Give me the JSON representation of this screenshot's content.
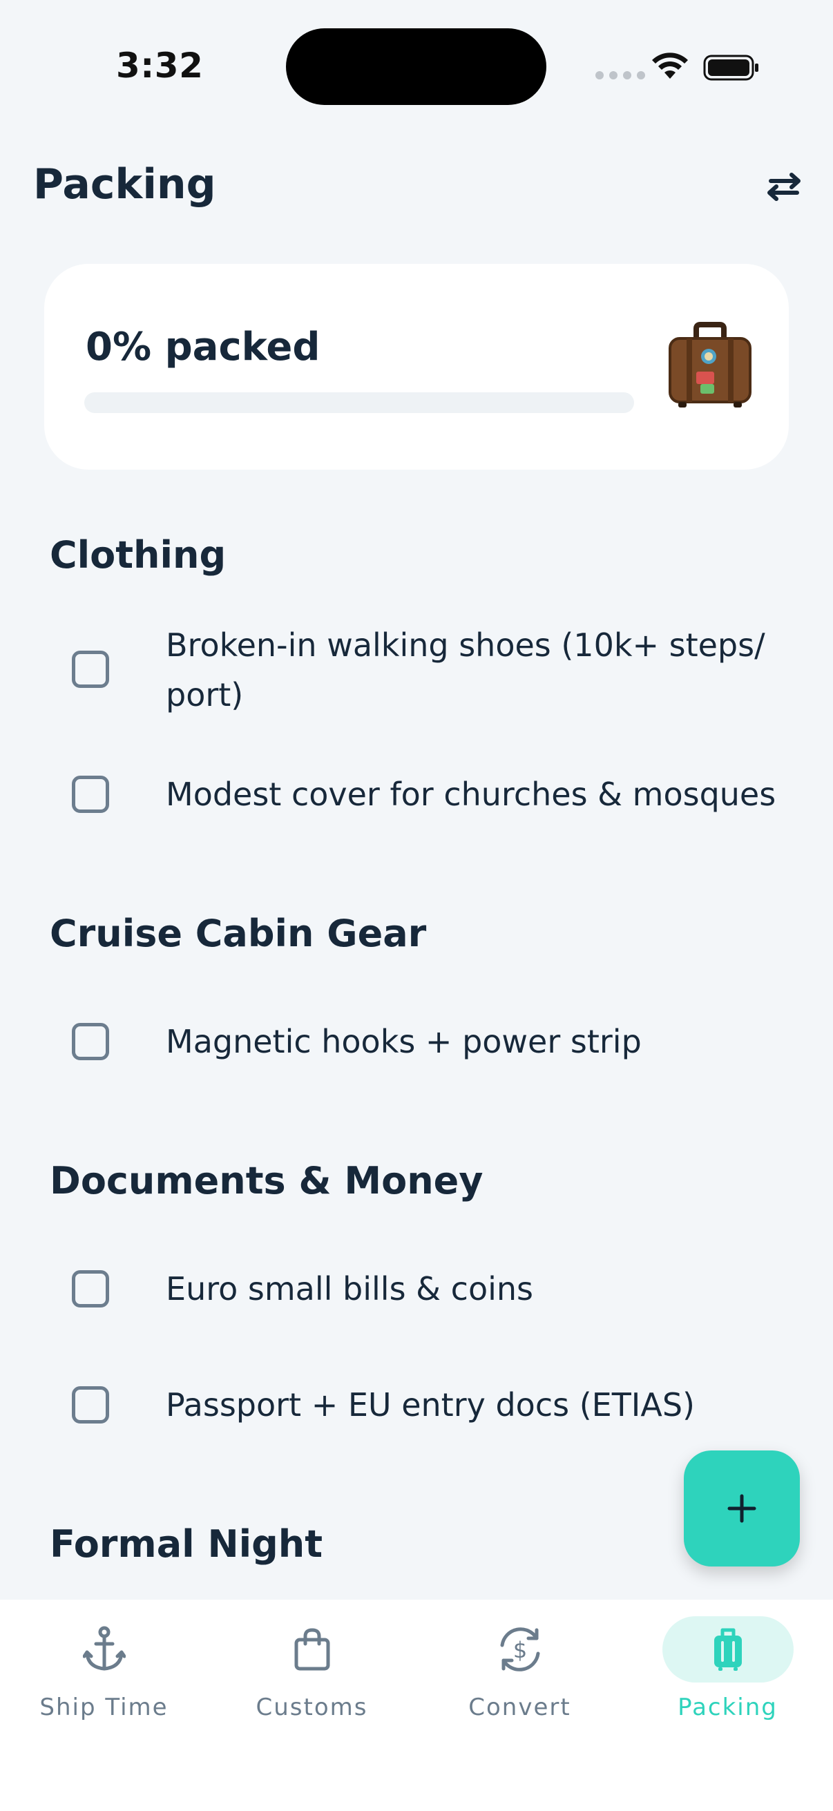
{
  "status_bar": {
    "time": "3:32"
  },
  "header": {
    "title": "Packing"
  },
  "progress": {
    "label": "0% packed",
    "fraction": 0.0
  },
  "sections": [
    {
      "title": "Clothing",
      "items": [
        {
          "label": "Broken-in walking shoes (10k+ steps/ port)",
          "checked": false
        },
        {
          "label": "Modest cover for churches & mosques",
          "checked": false
        }
      ]
    },
    {
      "title": "Cruise Cabin Gear",
      "items": [
        {
          "label": "Magnetic hooks + power strip",
          "checked": false
        }
      ]
    },
    {
      "title": "Documents & Money",
      "items": [
        {
          "label": "Euro small bills & coins",
          "checked": false
        },
        {
          "label": "Passport + EU entry docs (ETIAS)",
          "checked": false
        }
      ]
    },
    {
      "title": "Formal Night",
      "items": []
    }
  ],
  "fab": {
    "icon": "plus-icon"
  },
  "bottom_nav": {
    "items": [
      {
        "label": "Ship Time",
        "icon": "anchor-icon",
        "active": false
      },
      {
        "label": "Customs",
        "icon": "shopping-bag-icon",
        "active": false
      },
      {
        "label": "Convert",
        "icon": "currency-exchange-icon",
        "active": false
      },
      {
        "label": "Packing",
        "icon": "luggage-icon",
        "active": true
      }
    ]
  },
  "colors": {
    "accent": "#2ED3BC",
    "accent_soft": "#DDF7F3",
    "text_primary": "#17283A",
    "text_muted": "#6B7C8C",
    "background": "#F3F6F9",
    "card": "#FFFFFF"
  }
}
